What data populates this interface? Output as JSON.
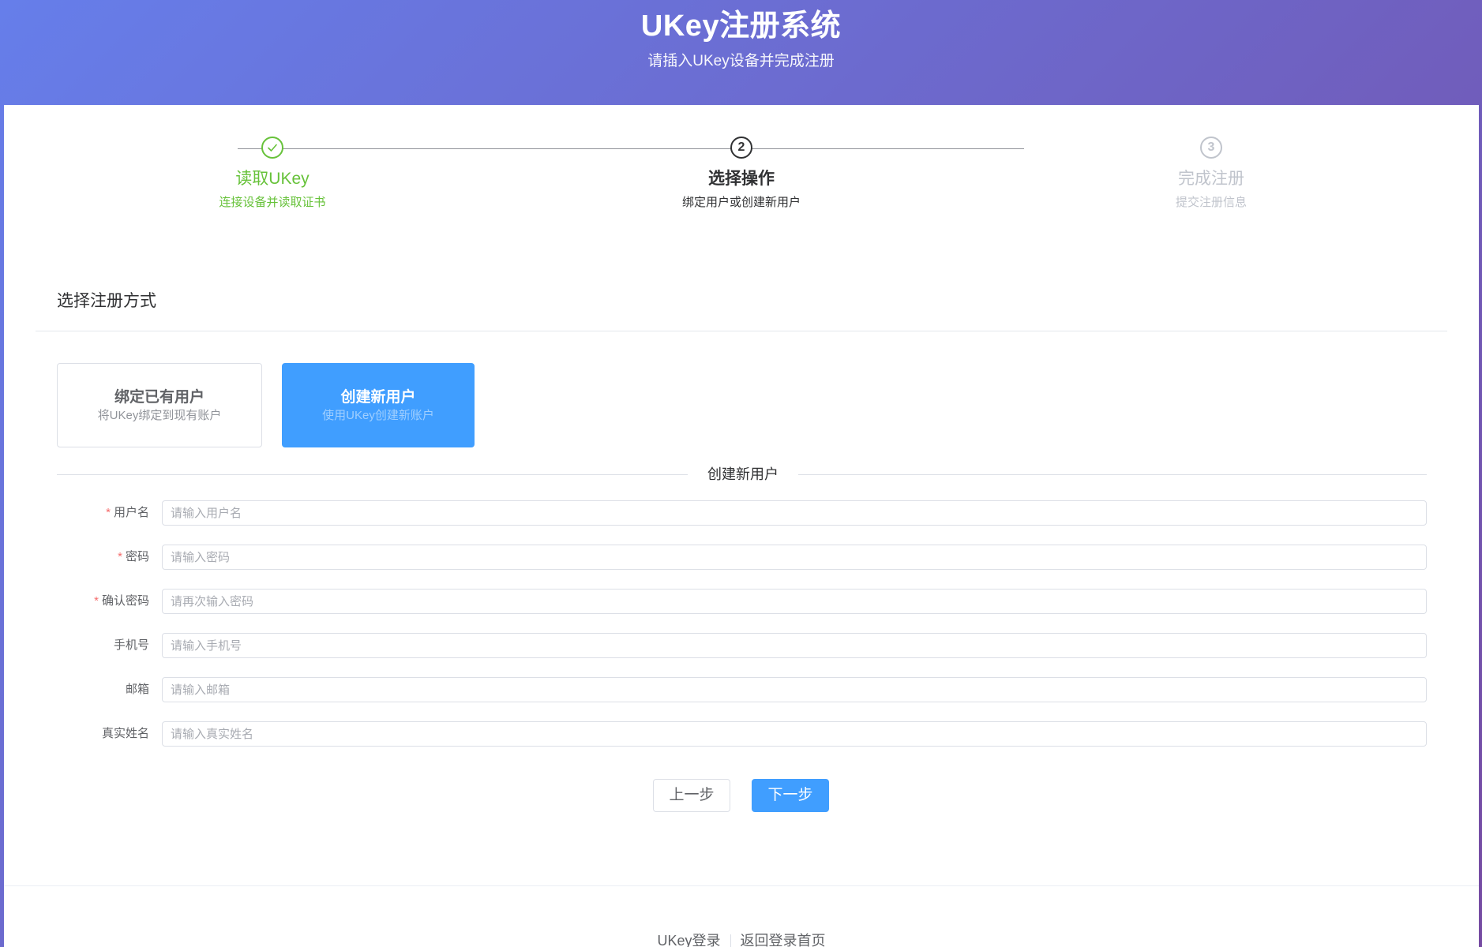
{
  "header": {
    "title": "UKey注册系统",
    "subtitle": "请插入UKey设备并完成注册"
  },
  "steps": [
    {
      "status": "success",
      "icon": "check-icon",
      "number": "",
      "title": "读取UKey",
      "description": "连接设备并读取证书"
    },
    {
      "status": "process",
      "icon": "",
      "number": "2",
      "title": "选择操作",
      "description": "绑定用户或创建新用户"
    },
    {
      "status": "wait",
      "icon": "",
      "number": "3",
      "title": "完成注册",
      "description": "提交注册信息"
    }
  ],
  "section": {
    "title": "选择注册方式"
  },
  "options": [
    {
      "title": "绑定已有用户",
      "subtitle": "将UKey绑定到现有账户",
      "selected": false
    },
    {
      "title": "创建新用户",
      "subtitle": "使用UKey创建新账户",
      "selected": true
    }
  ],
  "form": {
    "divider_text": "创建新用户",
    "fields": [
      {
        "label": "用户名",
        "required": true,
        "placeholder": "请输入用户名",
        "value": ""
      },
      {
        "label": "密码",
        "required": true,
        "placeholder": "请输入密码",
        "value": ""
      },
      {
        "label": "确认密码",
        "required": true,
        "placeholder": "请再次输入密码",
        "value": ""
      },
      {
        "label": "手机号",
        "required": false,
        "placeholder": "请输入手机号",
        "value": ""
      },
      {
        "label": "邮箱",
        "required": false,
        "placeholder": "请输入邮箱",
        "value": ""
      },
      {
        "label": "真实姓名",
        "required": false,
        "placeholder": "请输入真实姓名",
        "value": ""
      }
    ],
    "required_mark": "*"
  },
  "buttons": {
    "prev": "上一步",
    "next": "下一步"
  },
  "footer": {
    "links": [
      "UKey登录",
      "返回登录首页"
    ]
  },
  "colors": {
    "header_gradient_start": "#667eea",
    "header_gradient_end": "#764ba2",
    "primary": "#409eff",
    "success": "#67c23a",
    "required": "#f56c6c"
  }
}
